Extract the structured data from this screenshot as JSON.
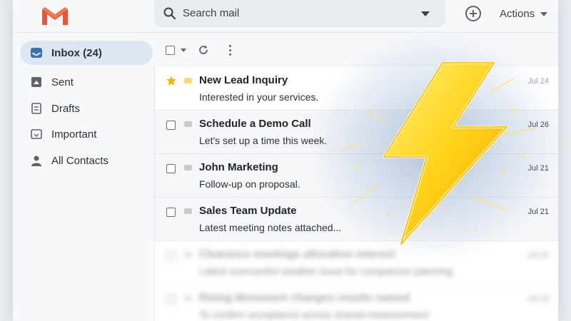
{
  "app": {
    "logo_icon": "gmail-m-logo",
    "search": {
      "placeholder": "Search mail",
      "icon": "search-icon"
    },
    "compose_icon": "plus-circle-icon",
    "actions_label": "Actions",
    "colors": {
      "accent_blue": "#dde6f3",
      "logo_red": "#e8553d",
      "bolt_yellow": "#ffd21a"
    }
  },
  "sidebar": {
    "items": [
      {
        "label": "Inbox (24)",
        "icon": "inbox-icon",
        "active": true
      },
      {
        "label": "Sent",
        "icon": "sent-icon",
        "active": false
      },
      {
        "label": "Drafts",
        "icon": "drafts-icon",
        "active": false
      },
      {
        "label": "Important",
        "icon": "important-icon",
        "active": false
      },
      {
        "label": "All Contacts",
        "icon": "contacts-icon",
        "active": false
      }
    ]
  },
  "toolbar": {
    "select_icon": "checkbox-icon",
    "refresh_icon": "refresh-icon",
    "more_icon": "more-vertical-icon"
  },
  "emails": [
    {
      "sender": "New Lead Inquiry",
      "snippet": "Interested in your services.",
      "date": "Jul 24",
      "starred": true
    },
    {
      "sender": "Schedule a Demo Call",
      "snippet": "Let's set up a time this week.",
      "date": "Jul 26",
      "starred": false
    },
    {
      "sender": "John Marketing",
      "snippet": "Follow-up on proposal.",
      "date": "Jul 21",
      "starred": false
    },
    {
      "sender": "Sales Team Update",
      "snippet": "Latest meeting notes attached...",
      "date": "Jul 21",
      "starred": false
    },
    {
      "sender": "Clearance meetings allocation interest",
      "snippet": "Latest overcareful weather issue for comparison planning",
      "date": "Jul 22",
      "starred": false
    },
    {
      "sender": "Rising Movement changes results named",
      "snippet": "To confirm acceptance across shared measurement",
      "date": "Jul 24",
      "starred": false
    }
  ],
  "overlay": {
    "icon": "lightning-bolt-icon"
  }
}
